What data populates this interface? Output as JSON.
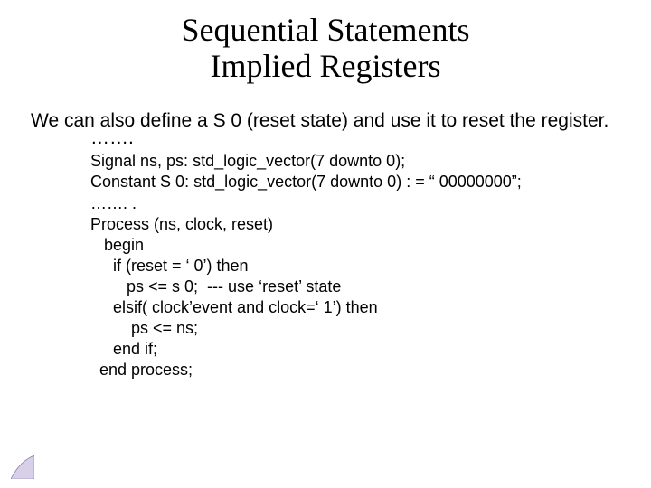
{
  "title_line1": "Sequential Statements",
  "title_line2": "Implied Registers",
  "intro": "We can also define a S 0 (reset state) and use it to reset the register.",
  "dots1": "…….",
  "code": {
    "l1": "Signal ns, ps: std_logic_vector(7 downto 0);",
    "l2": "Constant S 0: std_logic_vector(7 downto 0) : = “ 00000000”;",
    "l3": "……. .",
    "l4": "Process (ns, clock, reset)",
    "l5": "   begin",
    "l6": "     if (reset = ‘ 0’) then",
    "l7": "        ps <= s 0;  --- use ‘reset’ state",
    "l8": "     elsif( clock’event and clock=‘ 1’) then",
    "l9": "         ps <= ns;",
    "l10": "     end if;",
    "l11": "  end process;"
  }
}
